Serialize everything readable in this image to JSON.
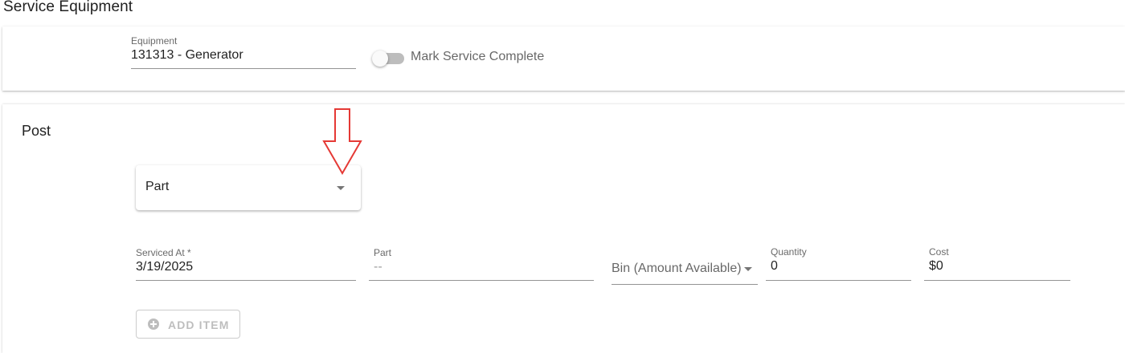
{
  "page": {
    "title": "Service Equipment"
  },
  "equipment": {
    "label": "Equipment",
    "value": "131313 - Generator"
  },
  "service_toggle": {
    "label": "Mark Service Complete",
    "checked": false
  },
  "post": {
    "title": "Post",
    "type_select": {
      "value": "Part"
    },
    "fields": {
      "serviced_at": {
        "label": "Serviced At *",
        "value": "3/19/2025"
      },
      "part": {
        "label": "Part",
        "value": "--"
      },
      "bin": {
        "label": "Bin (Amount Available)"
      },
      "quantity": {
        "label": "Quantity",
        "value": "0"
      },
      "cost": {
        "label": "Cost",
        "value": "$0"
      }
    },
    "add_item_button": {
      "label": "ADD ITEM",
      "disabled": true
    }
  },
  "colors": {
    "annotation_arrow": "#e53935",
    "toggle_track": "#bdbdbd",
    "underline": "#6b6b6b"
  },
  "icons": {
    "select_caret": "arrow-drop-down-icon",
    "add": "add-circle-icon",
    "annotation": "annotation-arrow-down-icon"
  }
}
